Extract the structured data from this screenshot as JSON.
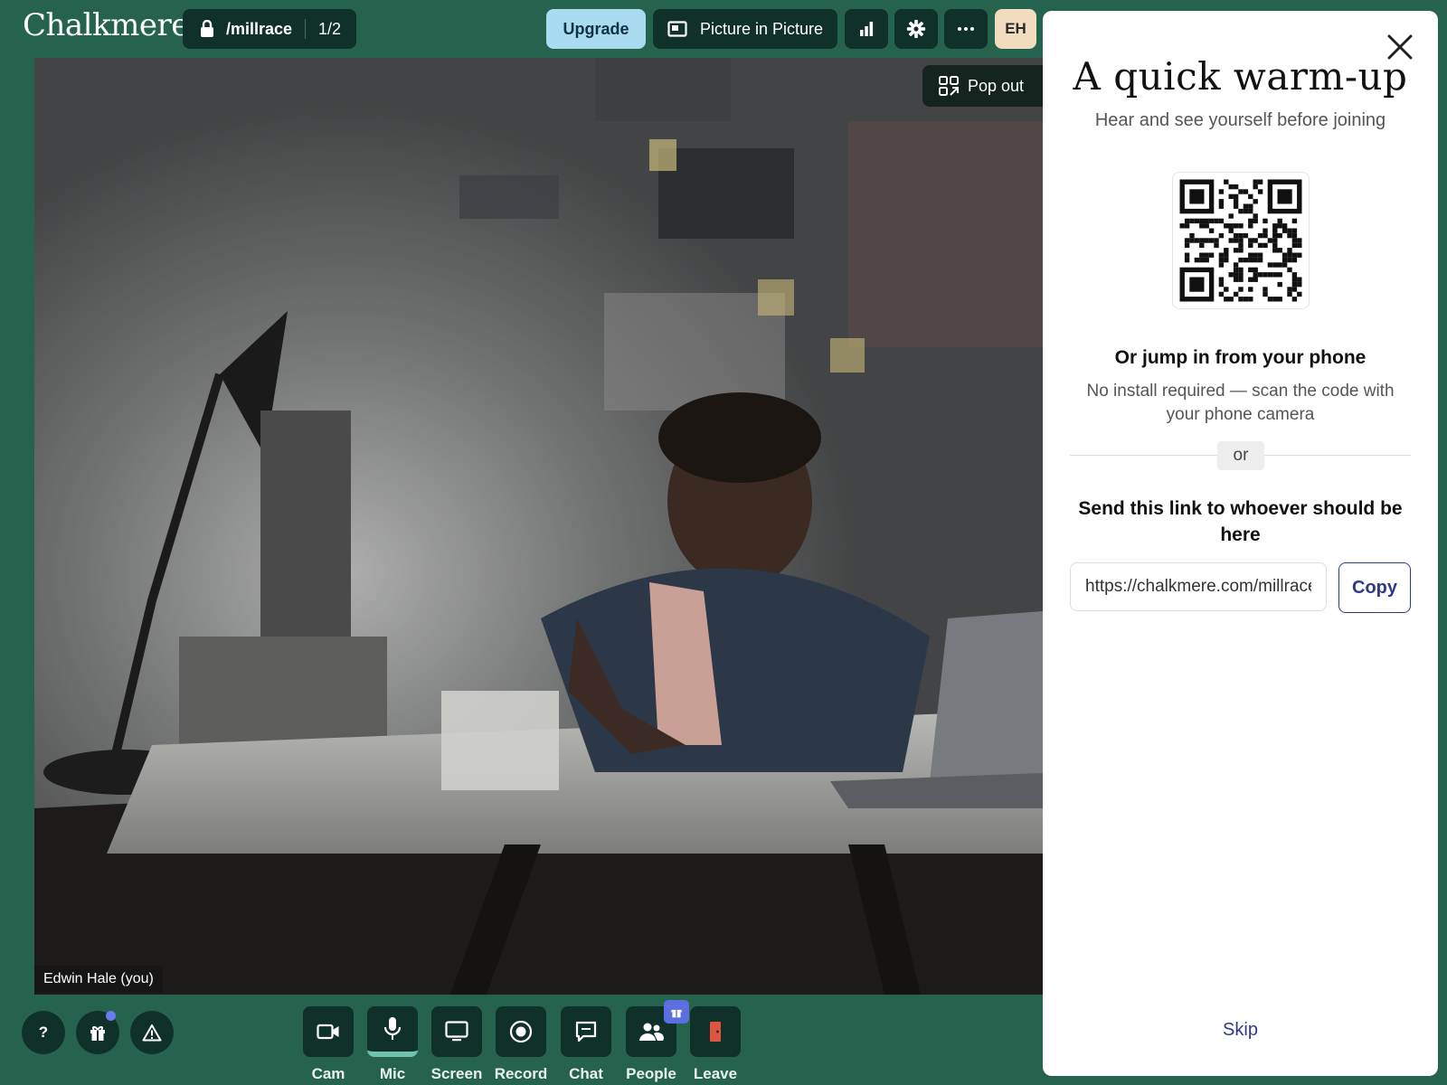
{
  "header": {
    "logo": "Chalkmere",
    "room_name": "/millrace",
    "room_count": "1/2",
    "upgrade_label": "Upgrade",
    "pip_label": "Picture in Picture",
    "avatar_initials": "EH"
  },
  "video": {
    "popout_label": "Pop out",
    "participant_name": "Edwin Hale (you)"
  },
  "panel": {
    "title": "A quick warm-up",
    "subtitle": "Hear and see yourself before joining",
    "phone_heading": "Or jump in from your phone",
    "phone_desc": "No install required — scan the code with your phone camera",
    "divider_label": "or",
    "send_heading": "Send this link to whoever should be here",
    "link_value": "https://chalkmere.com/millrace?",
    "copy_label": "Copy",
    "skip_label": "Skip"
  },
  "toolbar": {
    "cam": "Cam",
    "mic": "Mic",
    "screen": "Screen",
    "record": "Record",
    "chat": "Chat",
    "people": "People",
    "leave": "Leave"
  },
  "colors": {
    "background": "#26634f",
    "button_dark": "#10302a",
    "upgrade": "#a9dcf0",
    "accent": "#2f3a85",
    "leave_red": "#e0553f"
  }
}
